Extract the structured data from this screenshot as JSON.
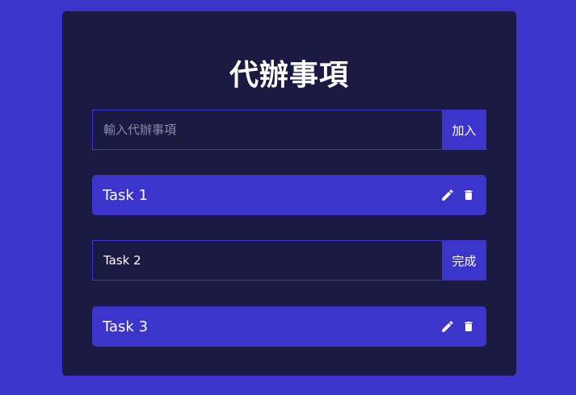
{
  "app": {
    "title": "代辦事項"
  },
  "new_todo": {
    "placeholder": "輸入代辦事項",
    "value": "",
    "add_label": "加入"
  },
  "todos": [
    {
      "text": "Task 1",
      "state": "view",
      "edit_icon": "pencil-icon",
      "delete_icon": "trash-icon"
    },
    {
      "text": "Task 2",
      "state": "editing",
      "done_label": "完成"
    },
    {
      "text": "Task 3",
      "state": "view",
      "edit_icon": "pencil-icon",
      "delete_icon": "trash-icon"
    }
  ],
  "colors": {
    "background": "#3b35cc",
    "card": "#1b1a43",
    "accent": "#3b35cc",
    "text": "#ffffff",
    "placeholder": "#8a8aa6"
  }
}
